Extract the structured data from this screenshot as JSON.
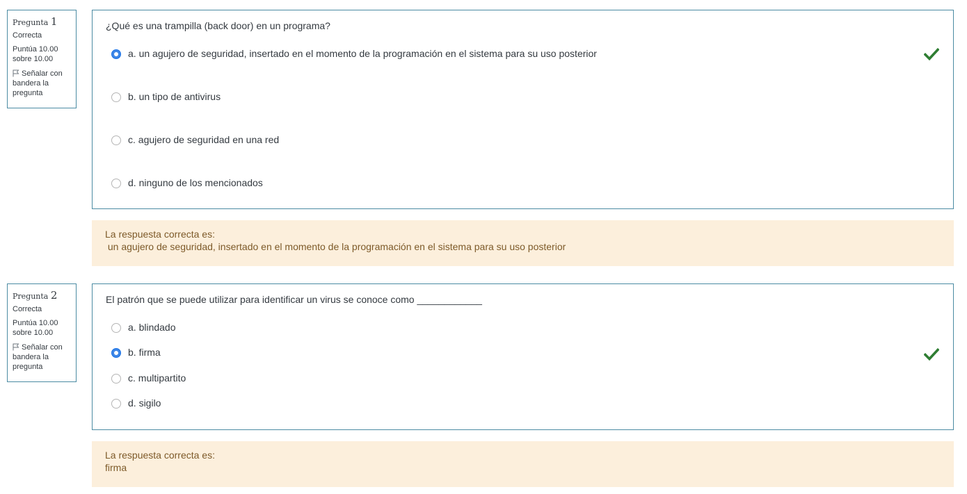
{
  "questions": [
    {
      "prefix": "Pregunta",
      "number": "1",
      "state": "Correcta",
      "grade_line1": "Puntúa 10.00",
      "grade_line2": "sobre 10.00",
      "flag_label": "Señalar con bandera la pregunta",
      "text": "¿Qué es una trampilla (back door) en un programa?",
      "options": [
        {
          "label": "a.  un agujero de seguridad, insertado en el momento de la programación en el sistema para su uso posterior",
          "selected": true
        },
        {
          "label": "b.  un tipo de antivirus",
          "selected": false
        },
        {
          "label": "c. agujero de seguridad en una red",
          "selected": false
        },
        {
          "label": "d. ninguno de los mencionados",
          "selected": false
        }
      ],
      "feedback_title": "La respuesta correcta es:",
      "feedback_answer": " un agujero de seguridad, insertado en el momento de la programación en el sistema para su uso posterior"
    },
    {
      "prefix": "Pregunta",
      "number": "2",
      "state": "Correcta",
      "grade_line1": "Puntúa 10.00",
      "grade_line2": "sobre 10.00",
      "flag_label": "Señalar con bandera la pregunta",
      "text": "El patrón que se puede utilizar para identificar un virus se conoce como ____________",
      "options": [
        {
          "label": "a. blindado",
          "selected": false
        },
        {
          "label": "b. firma",
          "selected": true
        },
        {
          "label": "c. multipartito",
          "selected": false
        },
        {
          "label": "d. sigilo",
          "selected": false
        }
      ],
      "feedback_title": "La respuesta correcta es:",
      "feedback_answer": "firma"
    }
  ],
  "icons": {
    "flag": "flag-icon",
    "correct": "check-icon"
  },
  "colors": {
    "border": "#4b8ba3",
    "selected_radio": "#3e86e6",
    "correct_check": "#2e7d32",
    "feedback_bg": "#fcefdc",
    "feedback_text": "#7d5a29"
  }
}
